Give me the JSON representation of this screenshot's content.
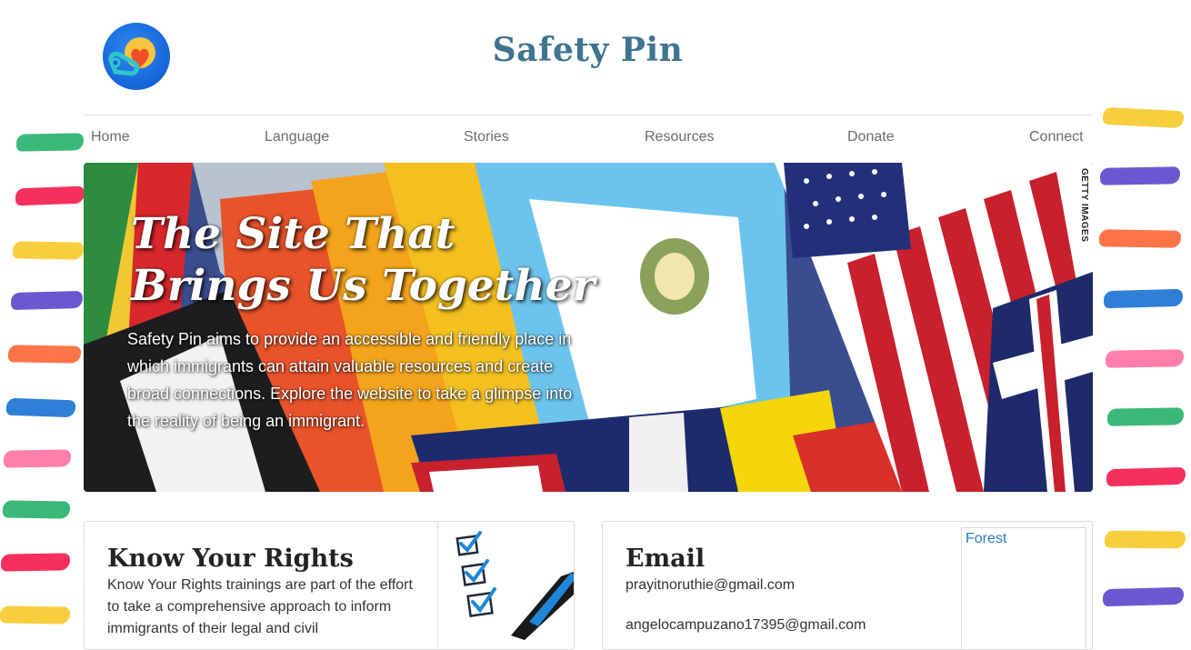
{
  "header": {
    "title": "Safety Pin",
    "logo_icon": "safety-pin-heart-icon"
  },
  "nav": {
    "items": [
      {
        "label": "Home"
      },
      {
        "label": "Language"
      },
      {
        "label": "Stories"
      },
      {
        "label": "Resources"
      },
      {
        "label": "Donate"
      },
      {
        "label": "Connect"
      }
    ]
  },
  "hero": {
    "title": "The Site That Brings Us Together",
    "text": "Safety Pin aims to provide an accessible and friendly place in which immigrants can attain valuable resources and create broad connections. Explore the website to take a glimpse into the reality of being an immigrant.",
    "watermark": "GETTY IMAGES"
  },
  "cards": {
    "rights": {
      "title": "Know Your Rights",
      "text": "Know Your Rights trainings are part of the effort to take a comprehensive approach to inform immigrants of their legal and civil",
      "image_icon": "checklist-pen-icon"
    },
    "email": {
      "title": "Email",
      "line1": "prayitnoruthie@gmail.com",
      "line2": "angelocampuzano17395@gmail.com",
      "side_link": "Forest"
    }
  },
  "colors": {
    "title": "#3f7590",
    "nav_text": "#6b6b6b",
    "link": "#2a7ac7",
    "strokes": [
      "#3ab878",
      "#f5305e",
      "#f7cf3e",
      "#6d57d1",
      "#ff7547",
      "#2f7fd6",
      "#ff7fa8"
    ]
  }
}
